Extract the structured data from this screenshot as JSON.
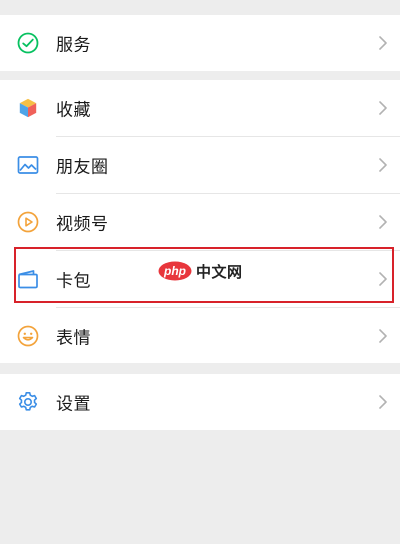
{
  "menu": {
    "groups": [
      {
        "items": [
          {
            "label": "服务",
            "icon": "service-check-icon"
          }
        ]
      },
      {
        "items": [
          {
            "label": "收藏",
            "icon": "favorites-cube-icon"
          },
          {
            "label": "朋友圈",
            "icon": "moments-picture-icon"
          },
          {
            "label": "视频号",
            "icon": "channels-play-icon"
          },
          {
            "label": "卡包",
            "icon": "card-wallet-icon"
          },
          {
            "label": "表情",
            "icon": "sticker-smile-icon"
          }
        ]
      },
      {
        "items": [
          {
            "label": "设置",
            "icon": "settings-gear-icon"
          }
        ]
      }
    ]
  },
  "overlay": {
    "watermark_text": "中文网",
    "watermark_logo": "php"
  },
  "colors": {
    "page_background": "#ededed",
    "row_background": "#ffffff",
    "highlight_border": "#d8222a",
    "label_text": "#191919",
    "chevron": "#b2b2b2"
  }
}
